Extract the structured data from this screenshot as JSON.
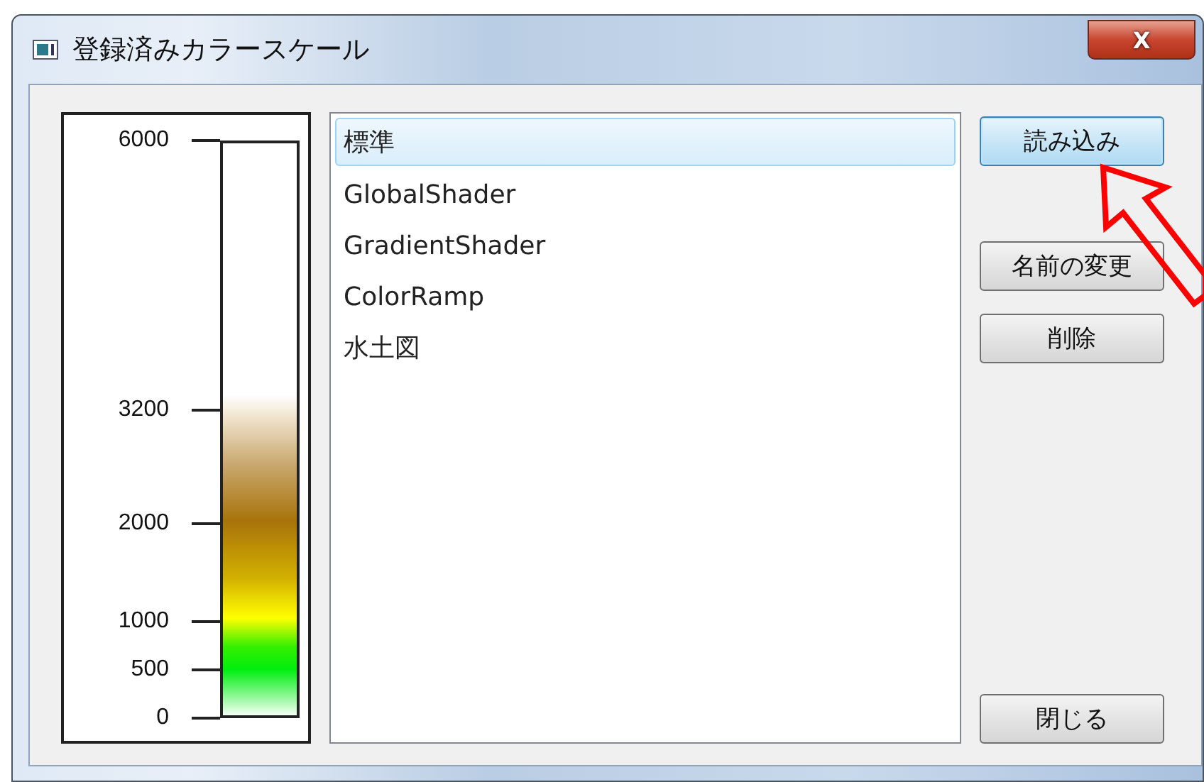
{
  "window": {
    "title": "登録済みカラースケール",
    "close_glyph": "X"
  },
  "scale": {
    "ticks": [
      {
        "label": "6000"
      },
      {
        "label": "3200"
      },
      {
        "label": "2000"
      },
      {
        "label": "1000"
      },
      {
        "label": "500"
      },
      {
        "label": "0"
      }
    ]
  },
  "list": {
    "items": [
      {
        "label": "標準",
        "selected": true
      },
      {
        "label": "GlobalShader",
        "selected": false
      },
      {
        "label": "GradientShader",
        "selected": false
      },
      {
        "label": "ColorRamp",
        "selected": false
      },
      {
        "label": "水土図",
        "selected": false
      }
    ]
  },
  "button_groups": [
    {
      "buttons": [
        {
          "label": "読み込み",
          "focused": true
        }
      ]
    },
    {
      "buttons": [
        {
          "label": "名前の変更",
          "focused": false
        },
        {
          "label": "削除",
          "focused": false
        }
      ]
    },
    {
      "buttons": [
        {
          "label": "閉じる",
          "focused": false
        }
      ]
    }
  ]
}
